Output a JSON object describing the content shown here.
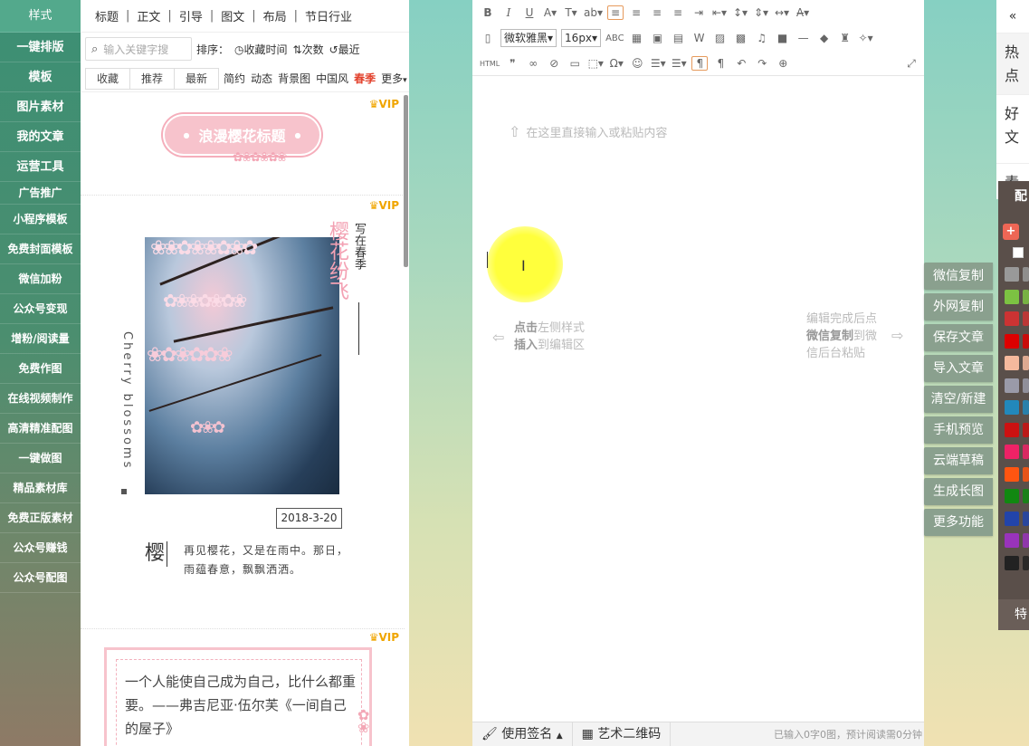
{
  "nav": {
    "items": [
      "样式",
      "一键排版",
      "模板",
      "图片素材",
      "我的文章",
      "运营工具",
      "广告推广",
      "小程序模板",
      "免费封面模板",
      "微信加粉",
      "公众号变现",
      "增粉/阅读量",
      "免费作图",
      "在线视频制作",
      "高清精准配图",
      "一键做图",
      "精品素材库",
      "免费正版素材",
      "公众号赚钱",
      "公众号配图"
    ]
  },
  "template_panel": {
    "tabs": [
      "标题",
      "正文",
      "引导",
      "图文",
      "布局",
      "节日行业"
    ],
    "search_placeholder": "输入关键字搜",
    "sort_label": "排序：",
    "sort_options": [
      "收藏时间",
      "次数",
      "最近"
    ],
    "filter_buttons": [
      "收藏",
      "推荐",
      "最新"
    ],
    "tags": [
      "简约",
      "动态",
      "背景图",
      "中国风",
      "春季",
      "更多"
    ],
    "vip_label": "VIP",
    "card1_title": "浪漫樱花标题",
    "card2": {
      "vertical_big": "樱花纷飞",
      "vertical_small": "写在春季",
      "english": "Cherry blossoms",
      "date": "2018-3-20",
      "big_char": "樱",
      "text": "再见樱花，又是在雨中。那日，雨蕴春意，飘飘洒洒。"
    },
    "card3_text": "一个人能使自己成为自己，比什么都重要。——弗吉尼亚·伍尔芙《一间自己的屋子》"
  },
  "editor": {
    "font_name": "微软雅黑",
    "font_size": "16px",
    "hint_top": "在这里直接输入或粘贴内容",
    "hint_left_1": "点击",
    "hint_left_2": "左侧样式",
    "hint_left_3": "插入",
    "hint_left_4": "到编辑区",
    "hint_right_1": "编辑完成后点",
    "hint_right_2": "微信复制",
    "hint_right_3": "到微",
    "hint_right_4": "信后台粘贴",
    "status_signature": "使用签名",
    "status_qr": "艺术二维码",
    "status_info": "已输入0字0图，预计阅读需0分钟"
  },
  "actions": [
    "微信复制",
    "外网复制",
    "保存文章",
    "导入文章",
    "清空/新建",
    "手机预览",
    "云端草稿",
    "生成长图",
    "更多功能"
  ],
  "far_right": {
    "collapse": "«",
    "tab1": "热点",
    "tab2": "好文",
    "tab3": "素资",
    "palette_head": "配",
    "palette_foot": "特"
  },
  "palette_colors": [
    "#ee6655",
    "#999999",
    "#7cc242",
    "#cc3333",
    "#dd0000",
    "#f5b99d",
    "#9a9aa8",
    "#2288bb",
    "#cc1111",
    "#ee2266",
    "#ff5511",
    "#118811",
    "#2244aa",
    "#9933bb",
    "#222222"
  ]
}
